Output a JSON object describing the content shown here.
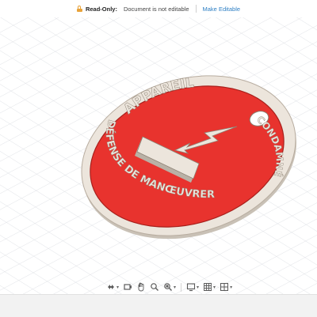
{
  "banner": {
    "read_only_label": "Read-Only:",
    "message": "Document is not editable",
    "action": "Make Editable"
  },
  "model": {
    "top_text": "APPAREIL",
    "right_text": "CONDAMNÉ",
    "left_text": "DÉFENSE DE MANŒUVRER",
    "lightning_icon": "lightning-bolt-arrow",
    "colors": {
      "disc": "#e8332e",
      "rim": "#ece5dc",
      "edge": "#a8201c",
      "grid": "#d6d9de"
    }
  },
  "toolbar": {
    "items": [
      "orbit-icon",
      "look-at-icon",
      "pan-icon",
      "zoom-icon",
      "fit-icon",
      "display-settings-icon",
      "grid-icon",
      "viewports-icon"
    ]
  }
}
